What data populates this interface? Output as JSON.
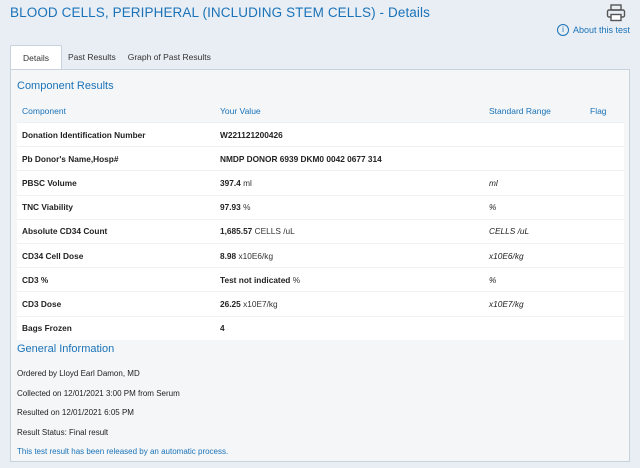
{
  "header": {
    "title": "BLOOD CELLS, PERIPHERAL (INCLUDING STEM CELLS) - Details",
    "about_link": "About this test",
    "print_icon": "printer-icon",
    "info_icon": "info-icon"
  },
  "tabs": [
    {
      "label": "Details",
      "active": true
    },
    {
      "label": "Past Results",
      "active": false
    },
    {
      "label": "Graph of Past Results",
      "active": false
    }
  ],
  "component_results": {
    "title": "Component Results",
    "columns": [
      "Component",
      "Your Value",
      "Standard Range",
      "Flag"
    ],
    "rows": [
      {
        "component": "Donation Identification Number",
        "value": "W221121200426",
        "unit": "",
        "range": "",
        "flag": ""
      },
      {
        "component": "Pb Donor's Name,Hosp#",
        "value": "NMDP DONOR 6939 DKM0 0042 0677 314",
        "unit": "",
        "range": "",
        "flag": ""
      },
      {
        "component": "PBSC Volume",
        "value": "397.4",
        "unit": "ml",
        "range": "ml",
        "flag": ""
      },
      {
        "component": "TNC Viability",
        "value": "97.93",
        "unit": "%",
        "range": "%",
        "flag": ""
      },
      {
        "component": "Absolute CD34 Count",
        "value": "1,685.57",
        "unit": "CELLS /uL",
        "range": "CELLS /uL",
        "flag": ""
      },
      {
        "component": "CD34 Cell Dose",
        "value": "8.98",
        "unit": "x10E6/kg",
        "range": "x10E6/kg",
        "flag": ""
      },
      {
        "component": "CD3 %",
        "value": "Test not indicated",
        "unit": "%",
        "range": "%",
        "flag": ""
      },
      {
        "component": "CD3 Dose",
        "value": "26.25",
        "unit": "x10E7/kg",
        "range": "x10E7/kg",
        "flag": ""
      },
      {
        "component": "Bags Frozen",
        "value": "4",
        "unit": "",
        "range": "",
        "flag": ""
      }
    ]
  },
  "general_info": {
    "title": "General Information",
    "ordered_by": "Ordered by Lloyd Earl Damon, MD",
    "collected": "Collected on 12/01/2021 3:00 PM from Serum",
    "resulted": "Resulted on 12/01/2021 6:05 PM",
    "status": "Result Status: Final result",
    "released": "This test result has been released by an automatic process."
  },
  "colors": {
    "accent": "#1a73b8",
    "background": "#e9eef4",
    "panel": "#f4f6f8"
  }
}
